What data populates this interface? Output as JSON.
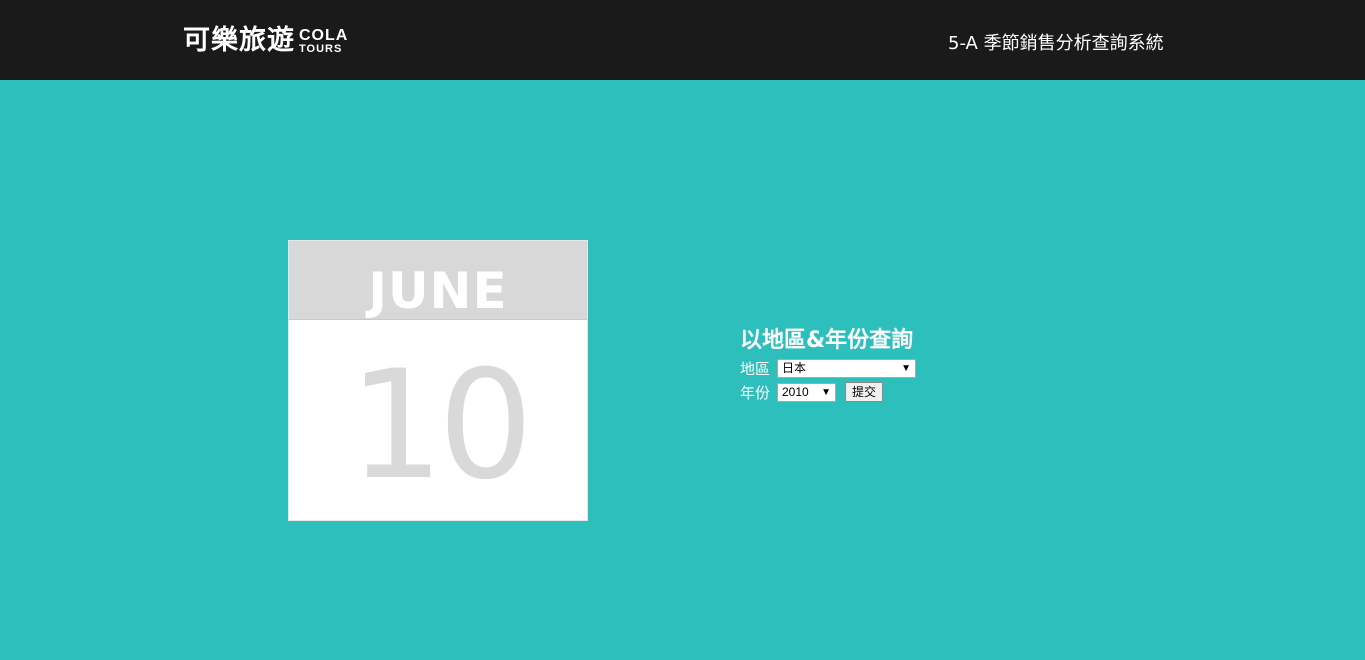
{
  "header": {
    "logo_cn": "可樂旅遊",
    "logo_en_top": "COLA",
    "logo_en_bottom": "TOURS",
    "system_title": "5-A 季節銷售分析查詢系統"
  },
  "calendar": {
    "month": "JUNE",
    "day": "10"
  },
  "query": {
    "title": "以地區&年份查詢",
    "region_label": "地區",
    "region_value": "日本",
    "year_label": "年份",
    "year_value": "2010",
    "submit_label": "提交"
  },
  "colors": {
    "header_bg": "#1a1a1a",
    "page_bg": "#2dbfbc",
    "calendar_header": "#d8d8d8",
    "calendar_digits": "#d9d9d9"
  }
}
